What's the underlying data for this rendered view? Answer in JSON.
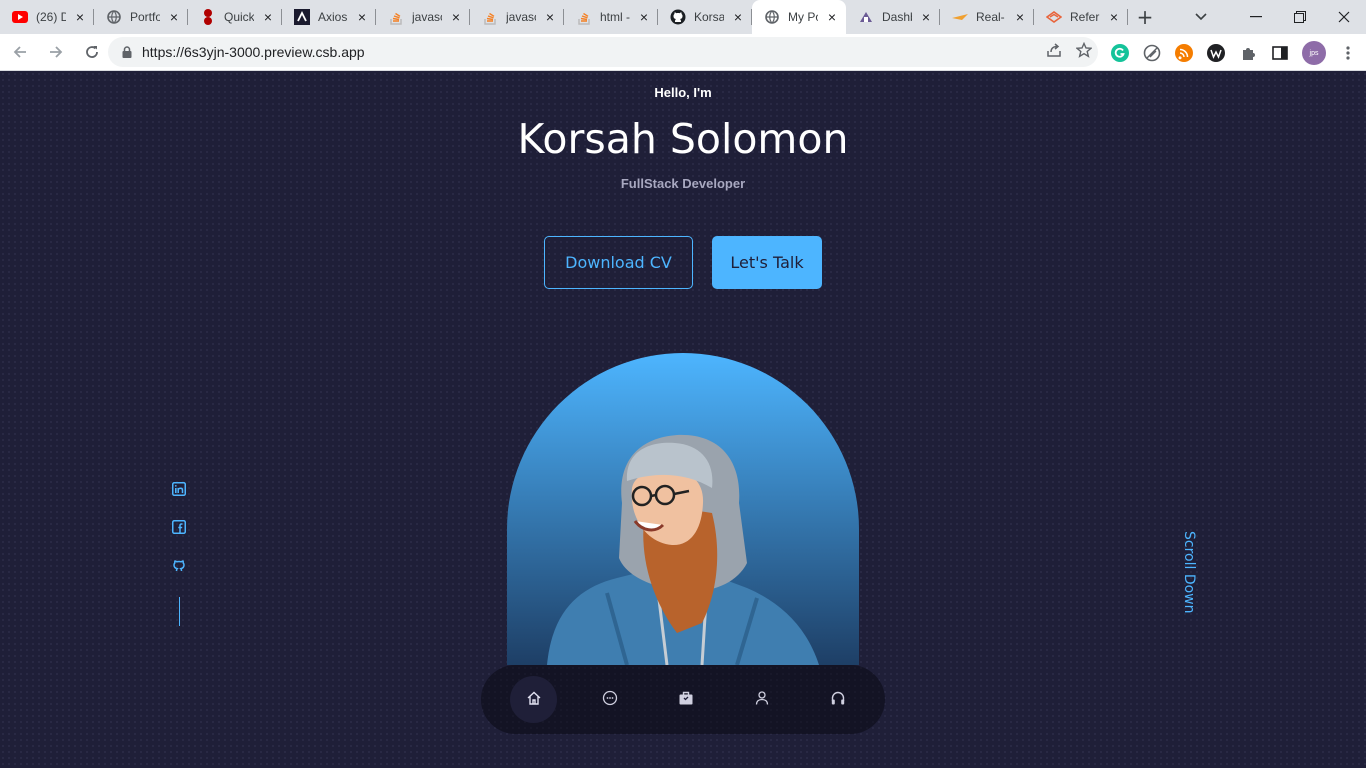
{
  "browser": {
    "tabs": [
      {
        "title": "(26) D",
        "icon": "youtube-icon"
      },
      {
        "title": "Portfo",
        "icon": "globe-icon"
      },
      {
        "title": "Quick",
        "icon": "redis-icon"
      },
      {
        "title": "Axios",
        "icon": "axios-icon"
      },
      {
        "title": "javasc",
        "icon": "stackoverflow-icon"
      },
      {
        "title": "javasc",
        "icon": "stackoverflow-icon"
      },
      {
        "title": "html -",
        "icon": "stackoverflow-icon"
      },
      {
        "title": "Korsa",
        "icon": "github-icon"
      },
      {
        "title": "My Po",
        "icon": "globe-icon",
        "active": true
      },
      {
        "title": "Dashb",
        "icon": "dashboard-icon"
      },
      {
        "title": "Real-",
        "icon": "plane-icon"
      },
      {
        "title": "Refer",
        "icon": "reference-icon"
      }
    ],
    "url": "https://6s3yjn-3000.preview.csb.app",
    "profile_initials": "jps"
  },
  "hero": {
    "greeting": "Hello, I'm",
    "name": "Korsah Solomon",
    "role": "FullStack Developer",
    "download_cv_label": "Download CV",
    "lets_talk_label": "Let's Talk"
  },
  "side": {
    "scroll_label": "Scroll Down"
  },
  "nav": {
    "items": [
      {
        "icon": "home-icon",
        "active": true
      },
      {
        "icon": "chat-icon"
      },
      {
        "icon": "briefcase-icon"
      },
      {
        "icon": "user-icon"
      },
      {
        "icon": "headphones-icon"
      }
    ]
  },
  "colors": {
    "accent": "#4db5ff",
    "background": "#1f1f38"
  }
}
